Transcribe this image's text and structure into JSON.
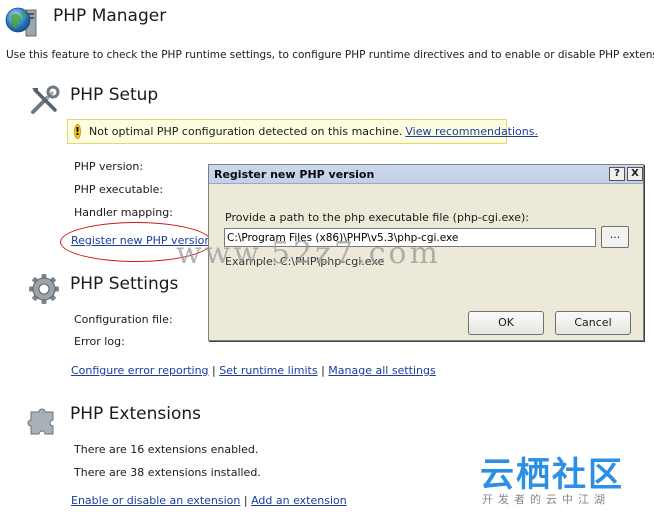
{
  "header": {
    "title": "PHP Manager",
    "description": "Use this feature to check the PHP runtime settings, to configure PHP runtime directives and to enable or disable PHP extensions."
  },
  "setup": {
    "title": "PHP Setup",
    "warning": {
      "text": "Not optimal PHP configuration detected on this machine.",
      "link": "View recommendations."
    },
    "labels": [
      "PHP version:",
      "PHP executable:",
      "Handler mapping:"
    ],
    "register_link": "Register new PHP version"
  },
  "settings": {
    "title": "PHP Settings",
    "labels": [
      "Configuration file:",
      "Error log:"
    ],
    "links": [
      "Configure error reporting",
      "Set runtime limits",
      "Manage all settings"
    ],
    "separator": "|"
  },
  "extensions": {
    "title": "PHP Extensions",
    "enabled_text": "There are 16 extensions enabled.",
    "installed_text": "There are 38 extensions installed.",
    "links": [
      "Enable or disable an extension",
      "Add an extension"
    ],
    "separator": "|"
  },
  "dialog": {
    "title": "Register new PHP version",
    "help_button": "?",
    "close_button": "X",
    "prompt": "Provide a path to the php executable file (php-cgi.exe):",
    "path_value": "C:\\Program Files (x86)\\PHP\\v5.3\\php-cgi.exe",
    "browse_label": "...",
    "example": "Example: C:\\PHP\\php-cgi.exe",
    "ok_label": "OK",
    "cancel_label": "Cancel"
  },
  "watermark": {
    "url": "www.52z7.com",
    "brand": "云栖社区",
    "tagline": "开发者的云中江湖"
  },
  "colors": {
    "link": "#1a3e9f",
    "warning_bg": "#fffde0",
    "dialog_bg": "#ece9d8",
    "title_bar": "#c2d1ea",
    "annotation_red": "#d01818",
    "watermark_blue": "#2c8fe6"
  },
  "icons": {
    "header": "globe-icon",
    "setup": "tools-icon",
    "settings": "gear-icon",
    "extensions": "puzzle-icon",
    "warning": "warning-icon"
  }
}
